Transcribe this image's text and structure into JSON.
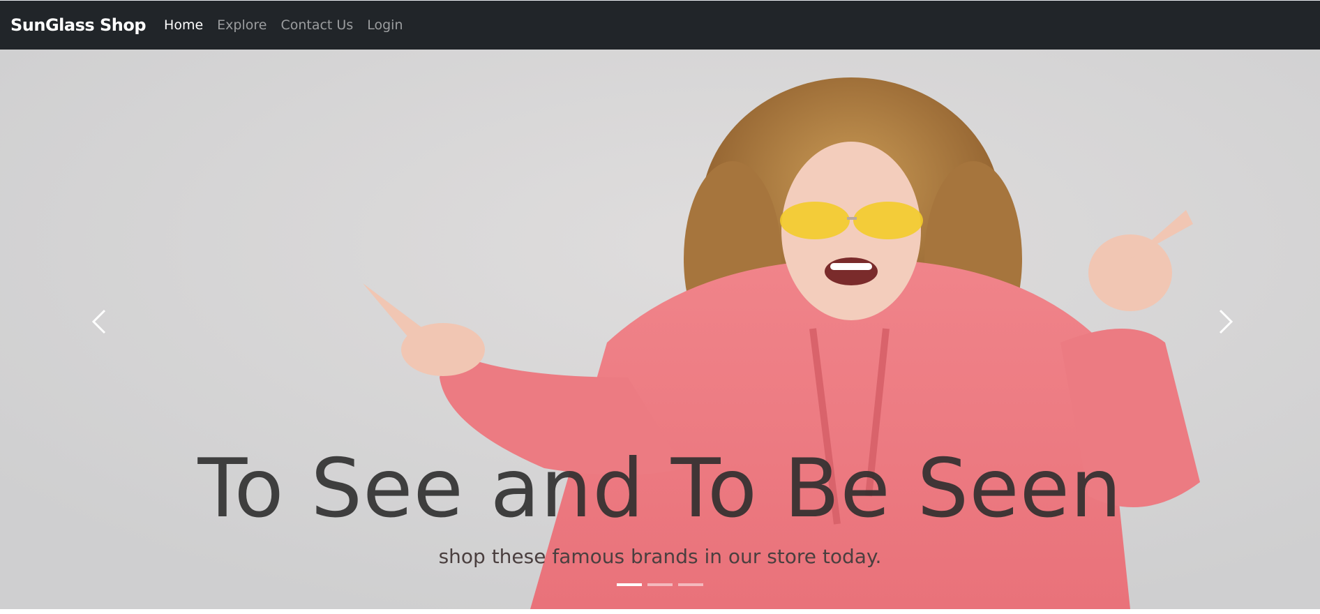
{
  "navbar": {
    "brand": "SunGlass Shop",
    "links": [
      "Home",
      "Explore",
      "Contact Us",
      "Login"
    ],
    "active": "Home"
  },
  "carousel": {
    "heading": "To See and To Be Seen",
    "subtext": "shop these famous brands in our store today.",
    "slides_count": 3,
    "active_slide": 1
  },
  "colors": {
    "navbar_bg": "#212529",
    "nav_active": "#ffffff",
    "nav_inactive": "#9b9d9f",
    "heading": "#3a3a3a",
    "hoodie": "#ec7a7f",
    "glasses_lens": "#f3cc2a"
  },
  "icons": {
    "prev": "chevron-left-icon",
    "next": "chevron-right-icon"
  }
}
